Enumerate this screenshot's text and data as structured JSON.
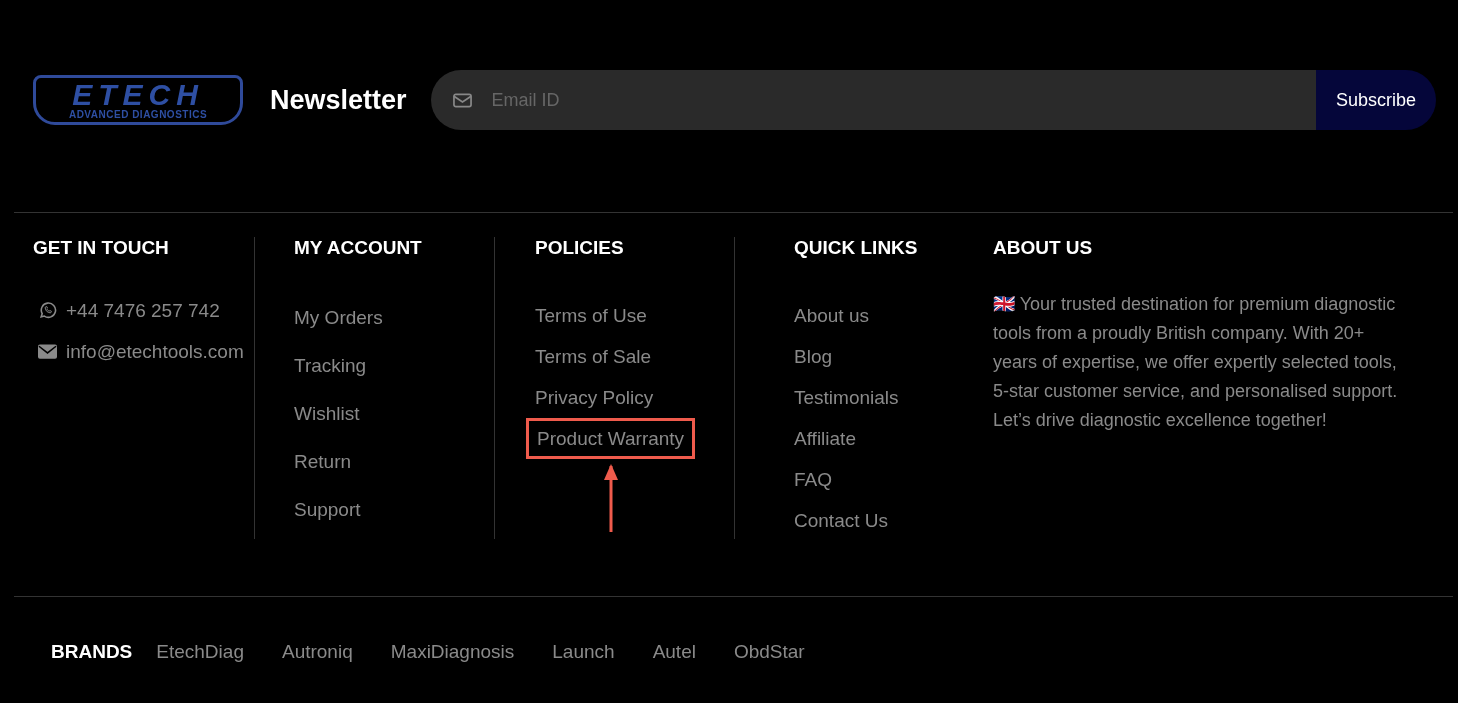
{
  "logo": {
    "wordmark": "ETECH",
    "tagline": "ADVANCED DIAGNOSTICS"
  },
  "newsletter": {
    "title": "Newsletter",
    "placeholder": "Email ID",
    "button": "Subscribe"
  },
  "columns": [
    {
      "title": "GET IN TOUCH",
      "kind": "contact",
      "items": [
        {
          "label": "+44 7476 257 742"
        },
        {
          "label": "info@etechtools.com"
        }
      ]
    },
    {
      "title": "MY ACCOUNT",
      "kind": "links",
      "items": [
        {
          "label": "My Orders",
          "highlighted": false
        },
        {
          "label": "Tracking",
          "highlighted": false
        },
        {
          "label": "Wishlist",
          "highlighted": false
        },
        {
          "label": "Return",
          "highlighted": false
        },
        {
          "label": "Support",
          "highlighted": false
        }
      ]
    },
    {
      "title": "POLICIES",
      "kind": "links",
      "items": [
        {
          "label": "Terms of Use",
          "highlighted": false
        },
        {
          "label": "Terms of Sale",
          "highlighted": false
        },
        {
          "label": "Privacy Policy",
          "highlighted": false
        },
        {
          "label": "Product Warranty",
          "highlighted": true
        }
      ]
    },
    {
      "title": "QUICK LINKS",
      "kind": "links",
      "items": [
        {
          "label": "About us",
          "highlighted": false
        },
        {
          "label": "Blog",
          "highlighted": false
        },
        {
          "label": "Testimonials",
          "highlighted": false
        },
        {
          "label": "Affiliate",
          "highlighted": false
        },
        {
          "label": "FAQ",
          "highlighted": false
        },
        {
          "label": "Contact Us",
          "highlighted": false
        }
      ]
    },
    {
      "title": "ABOUT US",
      "kind": "text",
      "text": "🇬🇧 Your trusted destination for premium diagnostic tools from a proudly British company. With 20+ years of expertise, we offer expertly selected tools, 5-star customer service, and personalised support. Let’s drive diagnostic excellence together!"
    }
  ],
  "brands": {
    "title": "BRANDS",
    "items": [
      "EtechDiag",
      "Autroniq",
      "MaxiDiagnosis",
      "Launch",
      "Autel",
      "ObdStar"
    ]
  }
}
